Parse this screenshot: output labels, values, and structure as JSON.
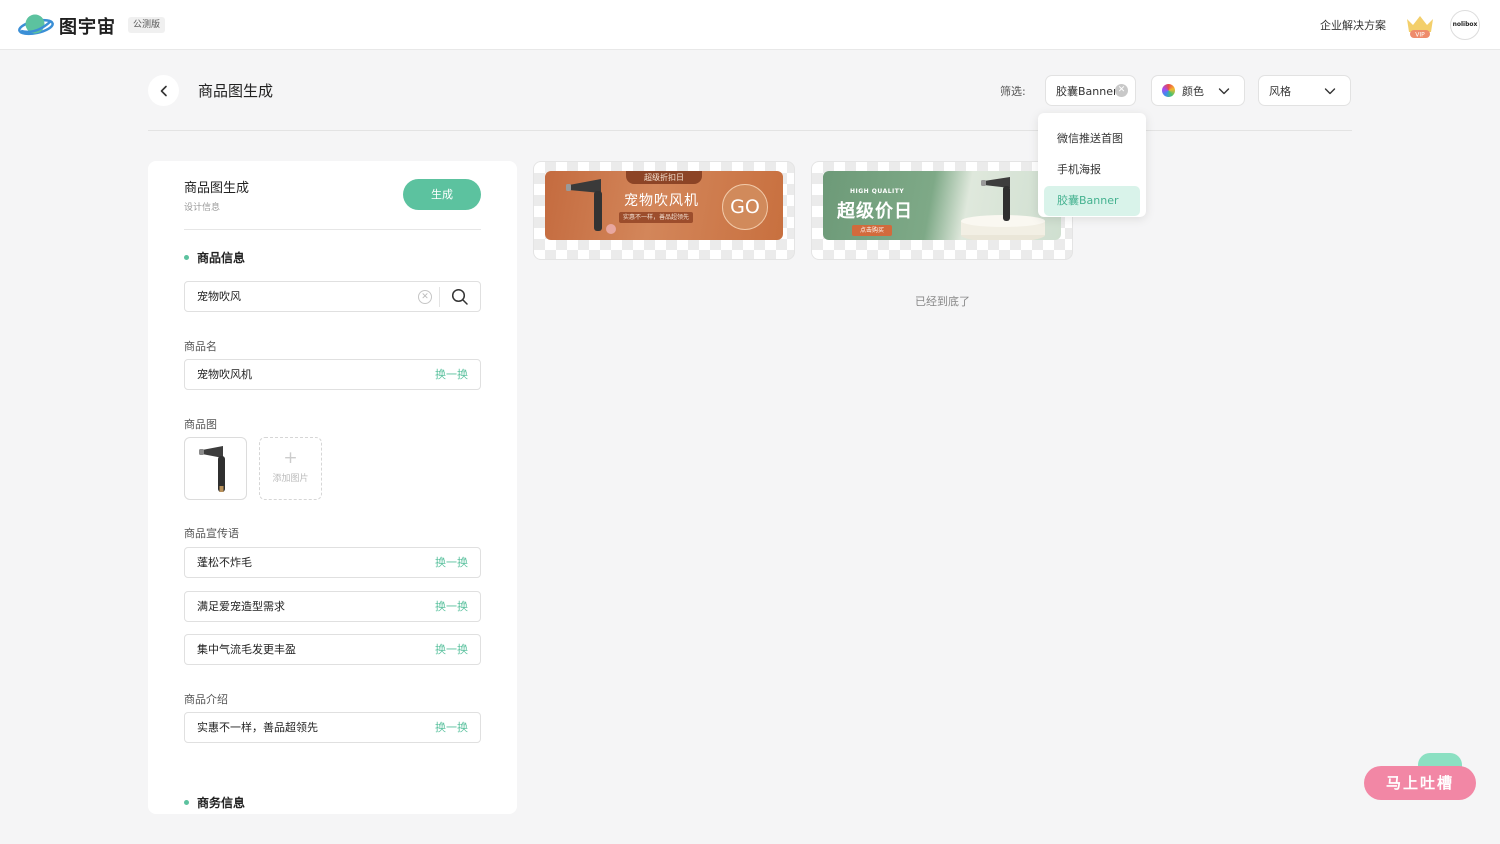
{
  "header": {
    "logo_text": "图宇宙",
    "beta_badge": "公测版",
    "enterprise_link": "企业解决方案",
    "vip_label": "VIP",
    "avatar_text": "nolibox"
  },
  "page": {
    "title": "商品图生成",
    "filter_label": "筛选:",
    "filters": {
      "type": "胶囊Banner",
      "color": "颜色",
      "style": "风格"
    },
    "dropdown_options": [
      "微信推送首图",
      "手机海报",
      "胶囊Banner"
    ],
    "dropdown_selected": "胶囊Banner"
  },
  "panel": {
    "title": "商品图生成",
    "subtitle": "设计信息",
    "generate_button": "生成",
    "product_section": "商品信息",
    "search_value": "宠物吹风",
    "name_label": "商品名",
    "name_value": "宠物吹风机",
    "swap_label": "换一换",
    "image_label": "商品图",
    "add_image_label": "添加图片",
    "slogan_label": "商品宣传语",
    "slogans": [
      "蓬松不炸毛",
      "满足爱宠造型需求",
      "集中气流毛发更丰盈"
    ],
    "intro_label": "商品介绍",
    "intro_value": "实惠不一样，善品超领先",
    "business_section": "商务信息"
  },
  "results": {
    "banner_1": {
      "tag": "超级折扣日",
      "title": "宠物吹风机",
      "subtitle": "实惠不一样，善品超领先",
      "cta": "GO"
    },
    "banner_2": {
      "small_text": "HIGH QUALITY",
      "title": "超级价日",
      "cta": "点击购买"
    },
    "end_text": "已经到底了"
  },
  "feedback": {
    "label": "马上吐槽"
  },
  "colors": {
    "accent": "#5cc29f",
    "selected_bg": "#d9f3ea",
    "feedback": "#f287a5"
  }
}
